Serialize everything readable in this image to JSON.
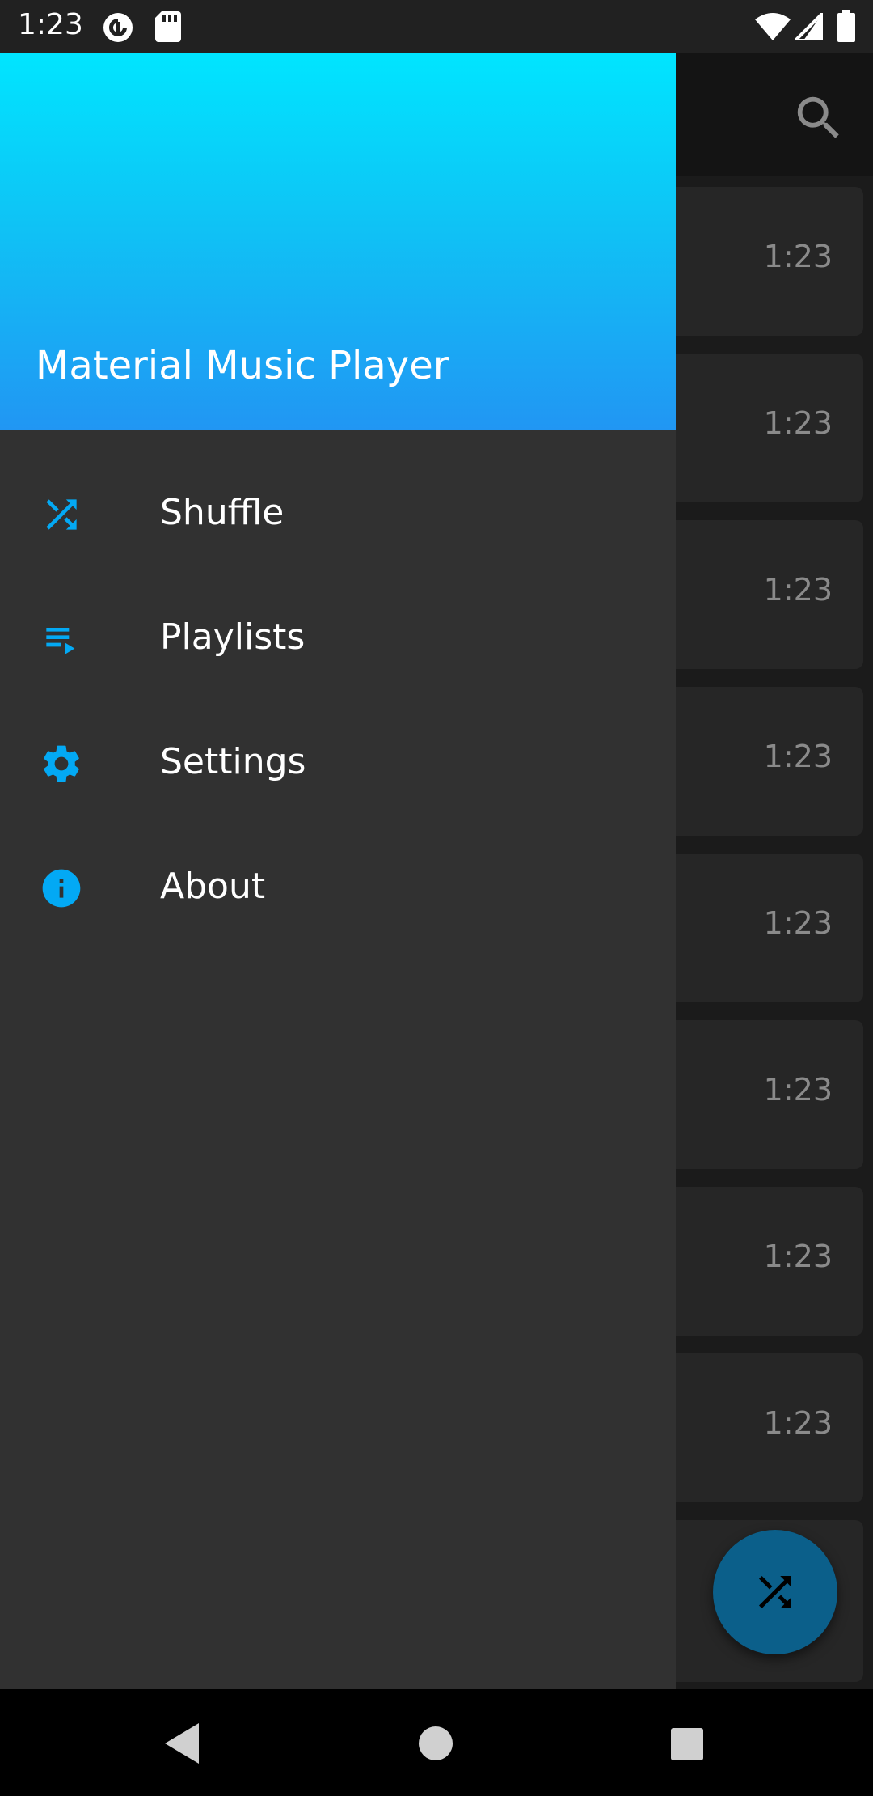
{
  "status_bar": {
    "time": "1:23",
    "left_icons": [
      "pocket-casts-icon",
      "sd-card-icon"
    ],
    "right_icons": [
      "wifi-icon",
      "cell-signal-icon",
      "battery-icon"
    ]
  },
  "background_app": {
    "toolbar": {
      "search_icon": "search-icon"
    },
    "songs": [
      {
        "duration": "1:23"
      },
      {
        "duration": "1:23"
      },
      {
        "duration": "1:23"
      },
      {
        "duration": "1:23"
      },
      {
        "duration": "1:23"
      },
      {
        "duration": "1:23"
      },
      {
        "duration": "1:23"
      },
      {
        "duration": "1:23"
      }
    ],
    "fab_icon": "shuffle-icon"
  },
  "drawer": {
    "title": "Material Music Player",
    "items": [
      {
        "label": "Shuffle",
        "icon": "shuffle-icon"
      },
      {
        "label": "Playlists",
        "icon": "playlist-play-icon"
      },
      {
        "label": "Settings",
        "icon": "gear-icon"
      },
      {
        "label": "About",
        "icon": "info-icon"
      }
    ]
  },
  "nav_bar": {
    "buttons": [
      "back-icon",
      "home-icon",
      "recents-icon"
    ]
  },
  "colors": {
    "accent": "#03a9f4",
    "header_top": "#00e5ff",
    "header_bottom": "#2196f3",
    "drawer_bg": "#313131",
    "fab": "#0b5f8a"
  }
}
